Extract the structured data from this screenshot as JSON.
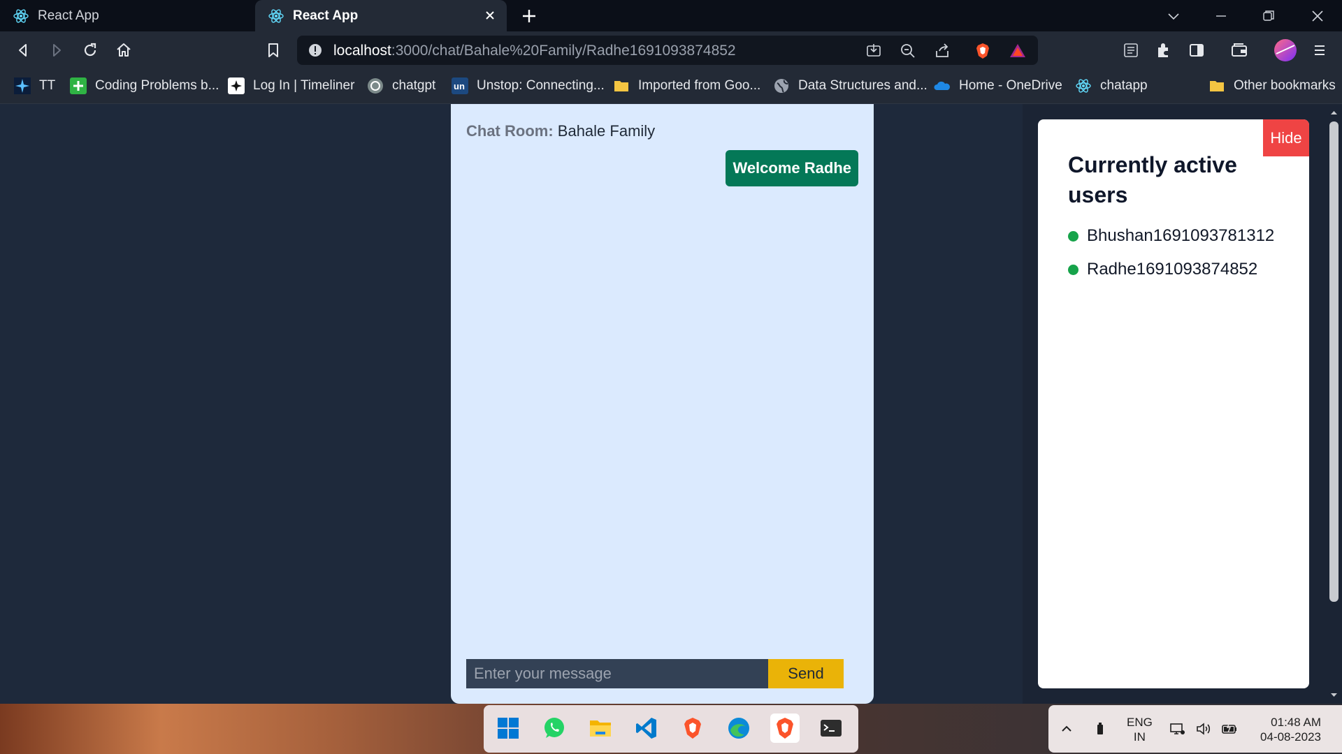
{
  "browser": {
    "tabs": [
      {
        "title": "React App",
        "active": false
      },
      {
        "title": "React App",
        "active": true
      }
    ],
    "url": {
      "host": "localhost",
      "path": ":3000/chat/Bahale%20Family/Radhe1691093874852"
    },
    "bookmarks": [
      {
        "label": "TT",
        "icon": "tt-icon"
      },
      {
        "label": "Coding Problems b...",
        "icon": "green-plus-icon"
      },
      {
        "label": "Log In | Timeliner",
        "icon": "timeliner-icon"
      },
      {
        "label": "chatgpt",
        "icon": "chatgpt-icon"
      },
      {
        "label": "Unstop: Connecting...",
        "icon": "unstop-icon"
      },
      {
        "label": "Imported from Goo...",
        "icon": "folder-icon"
      },
      {
        "label": "Data Structures and...",
        "icon": "globe-icon"
      },
      {
        "label": "Home - OneDrive",
        "icon": "onedrive-icon"
      },
      {
        "label": "chatapp",
        "icon": "react-icon"
      },
      {
        "label": "Other bookmarks",
        "icon": "folder-icon"
      }
    ]
  },
  "chat": {
    "room_label": "Chat Room:",
    "room_name": "Bahale Family",
    "welcome_message": "Welcome Radhe",
    "input_placeholder": "Enter your message",
    "send_label": "Send"
  },
  "active_users": {
    "title": "Currently active users",
    "hide_label": "Hide",
    "users": [
      "Bhushan1691093781312",
      "Radhe1691093874852"
    ]
  },
  "taskbar": {
    "apps": [
      "start-icon",
      "whatsapp-icon",
      "file-explorer-icon",
      "vscode-icon",
      "brave-icon",
      "edge-icon",
      "brave-active-icon",
      "terminal-icon"
    ],
    "language": {
      "line1": "ENG",
      "line2": "IN"
    },
    "time": "01:48 AM",
    "date": "04-08-2023"
  },
  "colors": {
    "page_bg": "#1e293b",
    "chat_bg": "#dbeafe",
    "welcome_bg": "#047857",
    "send_bg": "#eab308",
    "hide_bg": "#ef4444",
    "online_dot": "#16a34a"
  }
}
